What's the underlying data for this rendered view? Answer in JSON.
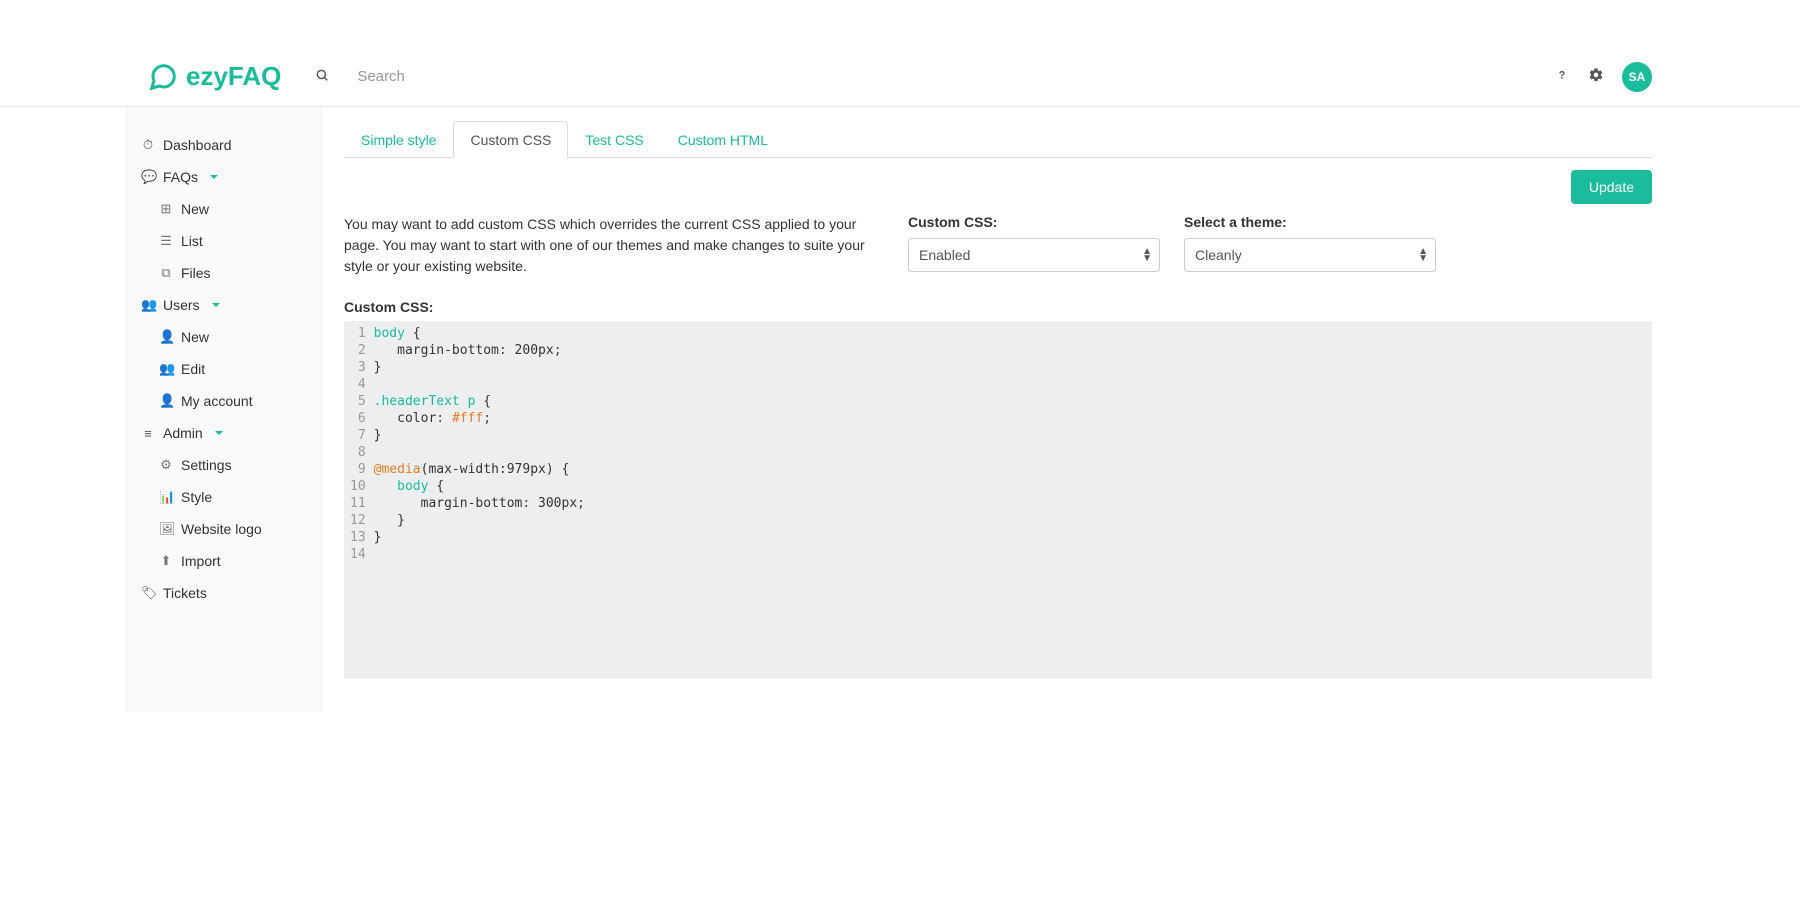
{
  "header": {
    "brand": "ezyFAQ",
    "search_placeholder": "Search",
    "avatar_initials": "SA"
  },
  "sidebar": {
    "dashboard": "Dashboard",
    "faqs": "FAQs",
    "faqs_new": "New",
    "faqs_list": "List",
    "faqs_files": "Files",
    "users": "Users",
    "users_new": "New",
    "users_edit": "Edit",
    "users_myaccount": "My account",
    "admin": "Admin",
    "admin_settings": "Settings",
    "admin_style": "Style",
    "admin_logo": "Website logo",
    "admin_import": "Import",
    "tickets": "Tickets"
  },
  "tabs": {
    "simple": "Simple style",
    "custom_css": "Custom CSS",
    "test_css": "Test CSS",
    "custom_html": "Custom HTML"
  },
  "buttons": {
    "update": "Update"
  },
  "intro_text": "You may want to add custom CSS which overrides the current CSS applied to your page. You may want to start with one of our themes and make changes to suite your style or your existing website.",
  "form": {
    "custom_css_label": "Custom CSS:",
    "custom_css_value": "Enabled",
    "theme_label": "Select a theme:",
    "theme_value": "Cleanly"
  },
  "editor": {
    "label": "Custom CSS:",
    "lines": [
      {
        "n": "1",
        "t": [
          {
            "c": "tok-sel",
            "v": "body"
          },
          {
            "c": "",
            "v": " {"
          }
        ]
      },
      {
        "n": "2",
        "t": [
          {
            "c": "",
            "v": "   margin-bottom"
          },
          {
            "c": "tok-punc",
            "v": ": "
          },
          {
            "c": "",
            "v": "200px"
          },
          {
            "c": "tok-punc",
            "v": ";"
          }
        ]
      },
      {
        "n": "3",
        "t": [
          {
            "c": "",
            "v": "}"
          }
        ]
      },
      {
        "n": "4",
        "t": [
          {
            "c": "",
            "v": ""
          }
        ]
      },
      {
        "n": "5",
        "t": [
          {
            "c": "tok-sel",
            "v": ".headerText p"
          },
          {
            "c": "",
            "v": " {"
          }
        ]
      },
      {
        "n": "6",
        "t": [
          {
            "c": "",
            "v": "   color"
          },
          {
            "c": "tok-punc",
            "v": ": "
          },
          {
            "c": "tok-color",
            "v": "#fff"
          },
          {
            "c": "tok-punc",
            "v": ";"
          }
        ]
      },
      {
        "n": "7",
        "t": [
          {
            "c": "",
            "v": "}"
          }
        ]
      },
      {
        "n": "8",
        "t": [
          {
            "c": "",
            "v": ""
          }
        ]
      },
      {
        "n": "9",
        "t": [
          {
            "c": "tok-media",
            "v": "@media"
          },
          {
            "c": "",
            "v": "("
          },
          {
            "c": "",
            "v": "max-width:979px"
          },
          {
            "c": "",
            "v": ") {"
          }
        ]
      },
      {
        "n": "10",
        "t": [
          {
            "c": "",
            "v": "   "
          },
          {
            "c": "tok-sel",
            "v": "body"
          },
          {
            "c": "",
            "v": " {"
          }
        ]
      },
      {
        "n": "11",
        "t": [
          {
            "c": "",
            "v": "      margin-bottom"
          },
          {
            "c": "tok-punc",
            "v": ": "
          },
          {
            "c": "",
            "v": "300px"
          },
          {
            "c": "tok-punc",
            "v": ";"
          }
        ]
      },
      {
        "n": "12",
        "t": [
          {
            "c": "",
            "v": "   }"
          }
        ]
      },
      {
        "n": "13",
        "t": [
          {
            "c": "",
            "v": "}"
          }
        ]
      },
      {
        "n": "14",
        "t": [
          {
            "c": "",
            "v": ""
          }
        ]
      }
    ]
  }
}
